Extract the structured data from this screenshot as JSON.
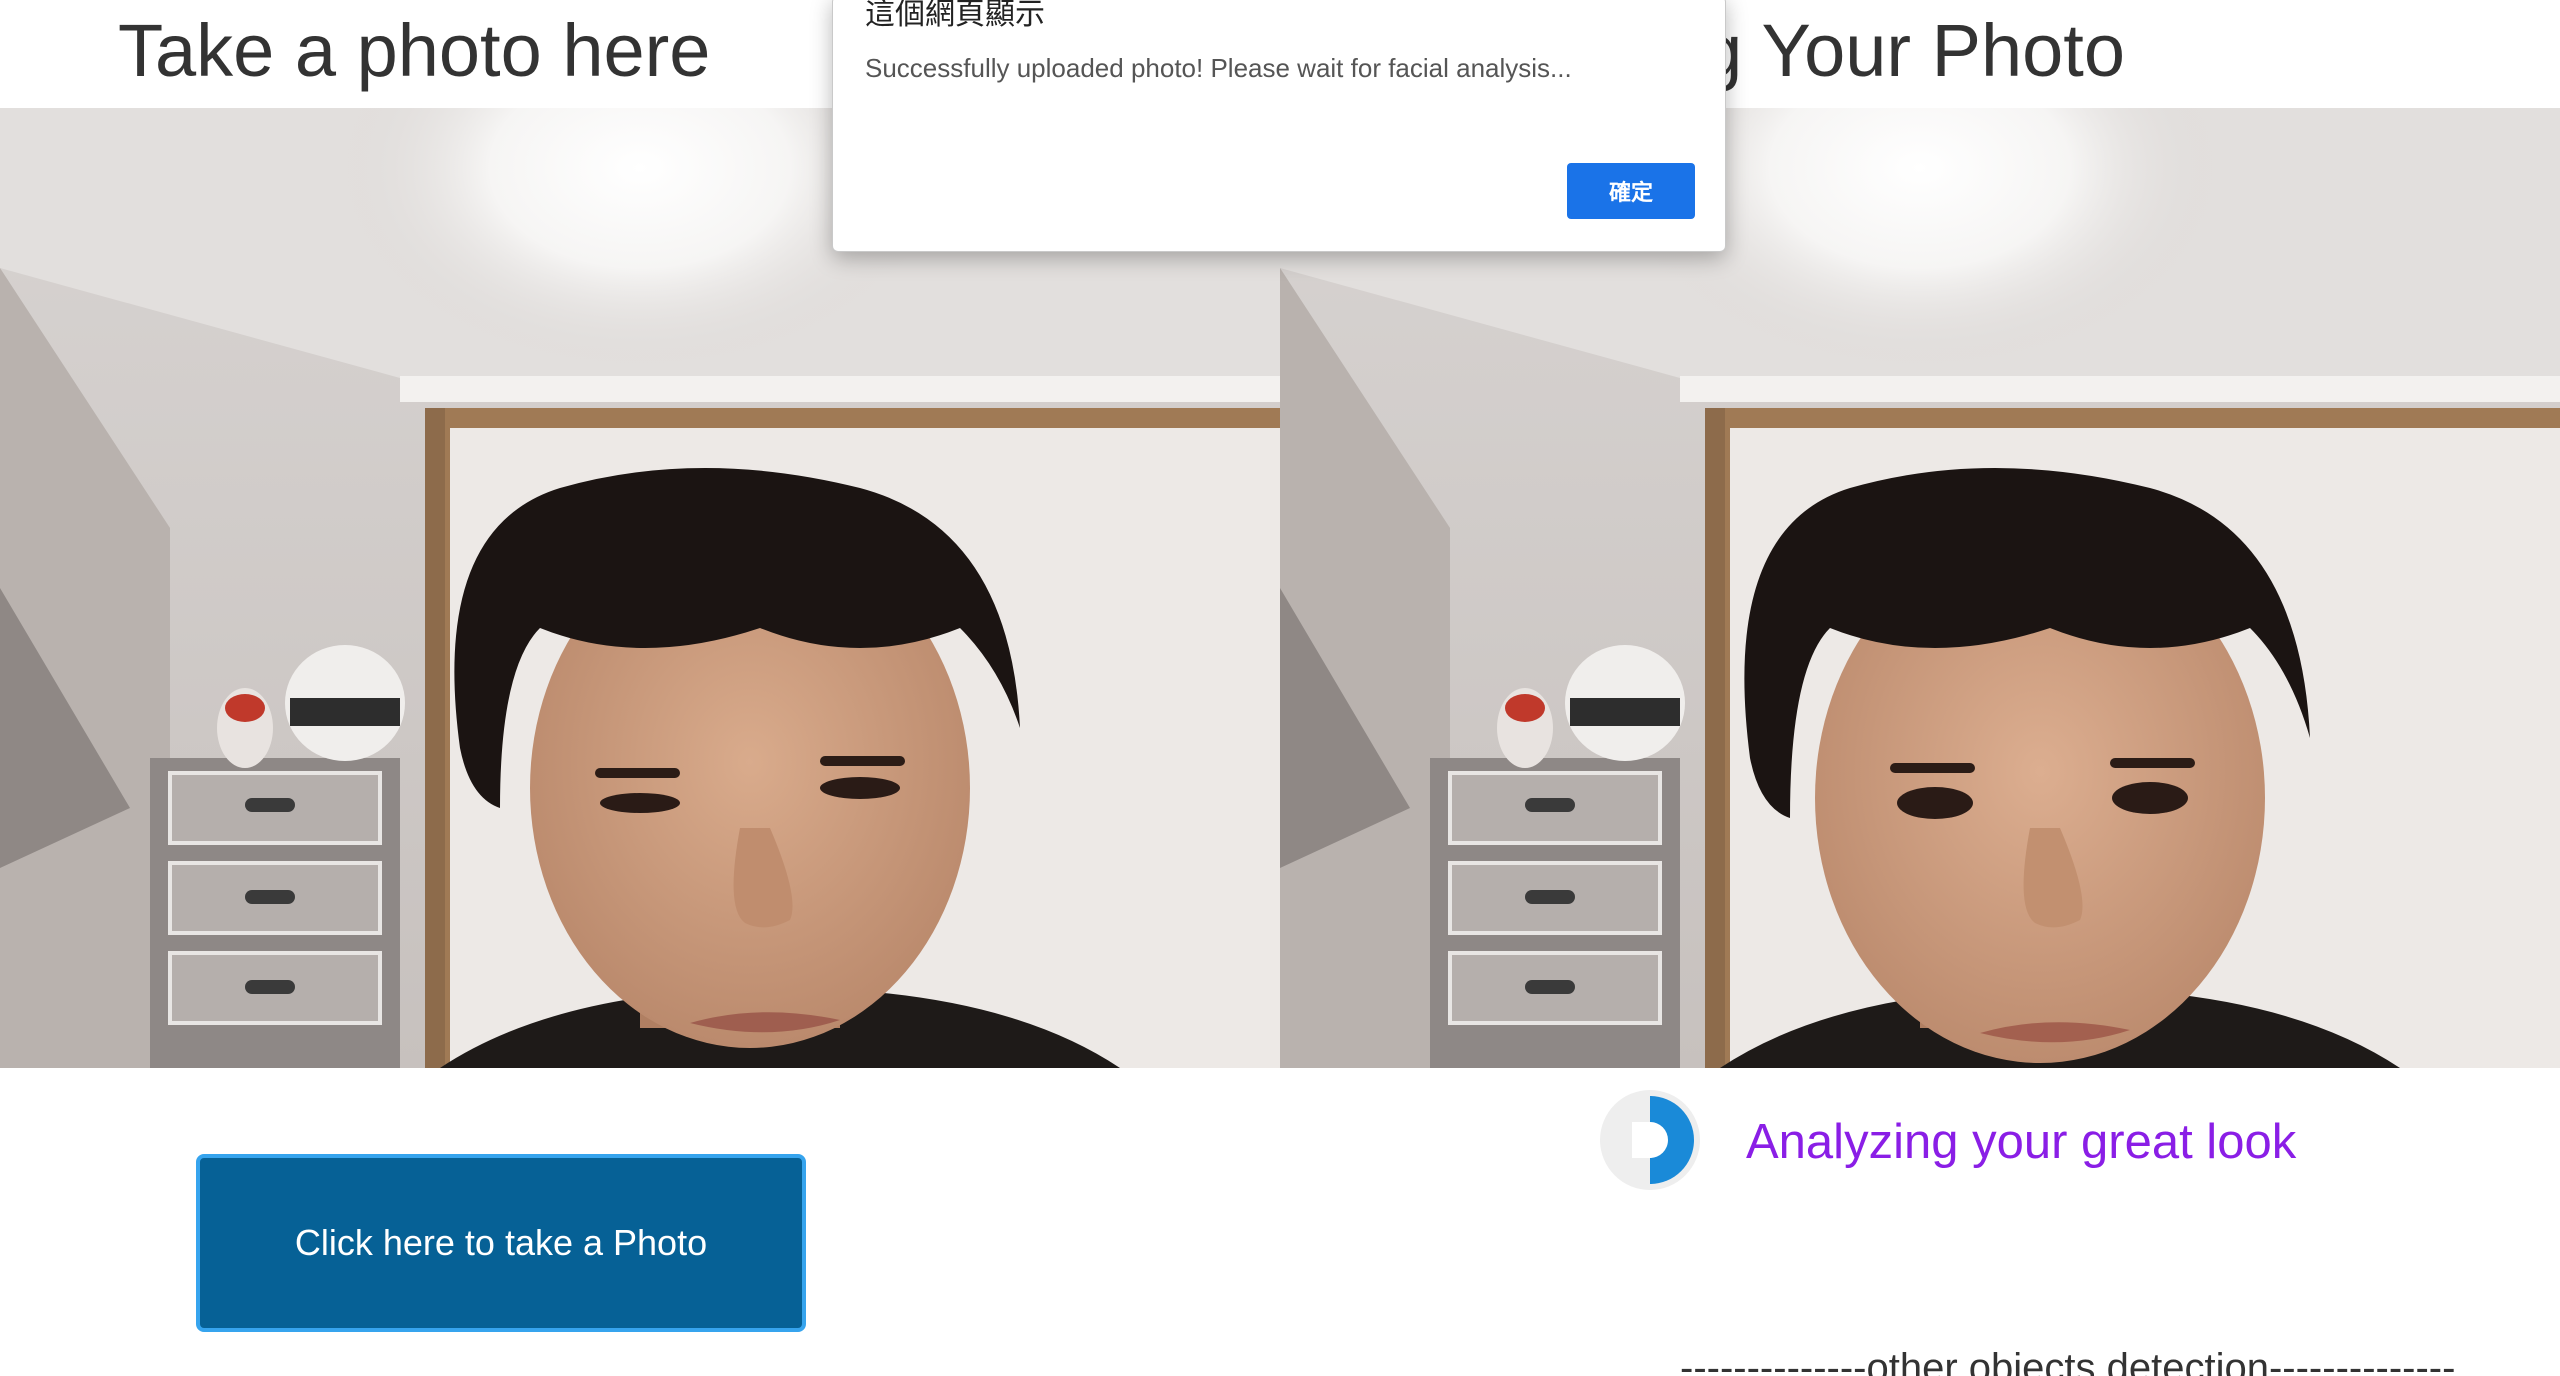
{
  "left_panel": {
    "title": "Take a photo here",
    "button_label": "Click here to take a Photo"
  },
  "right_panel": {
    "title": "ng Your Photo",
    "status_text": "Analyzing your great look"
  },
  "footer": {
    "detection_heading": "--------------other objects detection--------------"
  },
  "dialog": {
    "heading": "這個網頁顯示",
    "message": "Successfully uploaded photo! Please wait for facial analysis...",
    "ok_label": "確定"
  },
  "colors": {
    "button_bg": "#066196",
    "button_border": "#36a4ee",
    "status_text": "#8a1ee6",
    "dialog_button": "#1a73e8",
    "spinner_accent": "#1a8ad8"
  },
  "icons": {
    "spinner": "loading-spinner-icon"
  }
}
